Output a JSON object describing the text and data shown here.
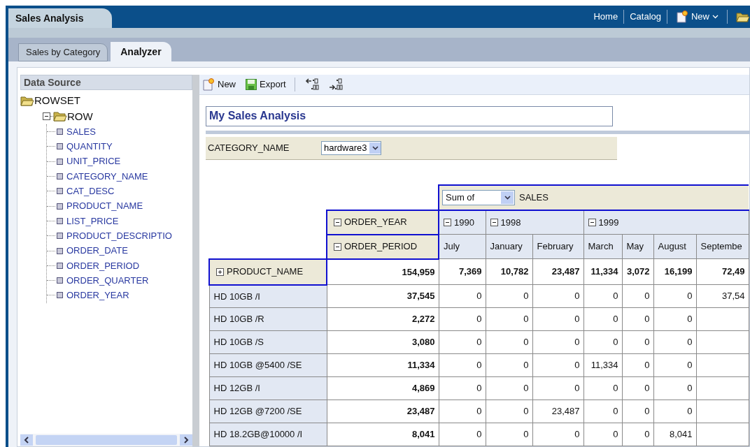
{
  "app_header": {
    "title": "Sales Analysis",
    "links": [
      {
        "label": "Home",
        "kind": "link"
      },
      {
        "label": "Catalog",
        "kind": "link"
      },
      {
        "label": "New",
        "kind": "menu"
      },
      {
        "kind": "folder"
      }
    ]
  },
  "tabs": [
    {
      "label": "Sales by Category",
      "selected": false
    },
    {
      "label": "Analyzer",
      "selected": true
    }
  ],
  "data_source": {
    "title": "Data Source",
    "tree": [
      {
        "label": "ROWSET",
        "kind": "root",
        "children": [
          {
            "label": "ROW",
            "kind": "folder",
            "expanded": true,
            "children": [
              {
                "label": "SALES",
                "kind": "field"
              },
              {
                "label": "QUANTITY",
                "kind": "field"
              },
              {
                "label": "UNIT_PRICE",
                "kind": "field"
              },
              {
                "label": "CATEGORY_NAME",
                "kind": "field"
              },
              {
                "label": "CAT_DESC",
                "kind": "field"
              },
              {
                "label": "PRODUCT_NAME",
                "kind": "field"
              },
              {
                "label": "LIST_PRICE",
                "kind": "field"
              },
              {
                "label": "PRODUCT_DESCRIPTIO",
                "kind": "field"
              },
              {
                "label": "ORDER_DATE",
                "kind": "field"
              },
              {
                "label": "ORDER_PERIOD",
                "kind": "field"
              },
              {
                "label": "ORDER_QUARTER",
                "kind": "field"
              },
              {
                "label": "ORDER_YEAR",
                "kind": "field"
              }
            ]
          }
        ]
      }
    ]
  },
  "toolbar": [
    {
      "label": "New",
      "kind": "new"
    },
    {
      "label": "Export",
      "kind": "export"
    },
    {
      "kind": "decimal-less"
    },
    {
      "kind": "decimal-more"
    }
  ],
  "report": {
    "title": "My Sales Analysis",
    "filter": {
      "label": "CATEGORY_NAME",
      "value": "hardware3"
    },
    "pivot": {
      "aggregate": "Sum of",
      "measure": "SALES",
      "column_fields": [
        {
          "label": "ORDER_YEAR",
          "expanded": true
        },
        {
          "label": "ORDER_PERIOD",
          "expanded": true
        }
      ],
      "row_field": {
        "label": "PRODUCT_NAME",
        "expanded": false
      },
      "years": [
        {
          "label": "1990",
          "expanded": true,
          "periods": [
            "July"
          ]
        },
        {
          "label": "1998",
          "expanded": true,
          "periods": [
            "January",
            "February"
          ]
        },
        {
          "label": "1999",
          "expanded": true,
          "periods": [
            "March",
            "May",
            "August",
            "Septembe"
          ]
        }
      ],
      "total_row": {
        "total": "154,959",
        "values": [
          "7,369",
          "10,782",
          "23,487",
          "11,334",
          "3,072",
          "16,199",
          "72,49"
        ]
      },
      "rows": [
        {
          "product": "HD 10GB /I",
          "total": "37,545",
          "values": [
            "0",
            "0",
            "0",
            "0",
            "0",
            "0",
            "37,54"
          ]
        },
        {
          "product": "HD 10GB /R",
          "total": "2,272",
          "values": [
            "0",
            "0",
            "0",
            "0",
            "0",
            "0"
          ]
        },
        {
          "product": "HD 10GB /S",
          "total": "3,080",
          "values": [
            "0",
            "0",
            "0",
            "0",
            "0",
            "0"
          ]
        },
        {
          "product": "HD 10GB @5400 /SE",
          "total": "11,334",
          "values": [
            "0",
            "0",
            "0",
            "11,334",
            "0",
            "0"
          ]
        },
        {
          "product": "HD 12GB /I",
          "total": "4,869",
          "values": [
            "0",
            "0",
            "0",
            "0",
            "0",
            "0"
          ]
        },
        {
          "product": "HD 12GB @7200 /SE",
          "total": "23,487",
          "values": [
            "0",
            "0",
            "23,487",
            "0",
            "0",
            "0"
          ]
        },
        {
          "product": "HD 18.2GB@10000 /I",
          "total": "8,041",
          "values": [
            "0",
            "0",
            "0",
            "0",
            "0",
            "8,041"
          ]
        }
      ]
    }
  }
}
